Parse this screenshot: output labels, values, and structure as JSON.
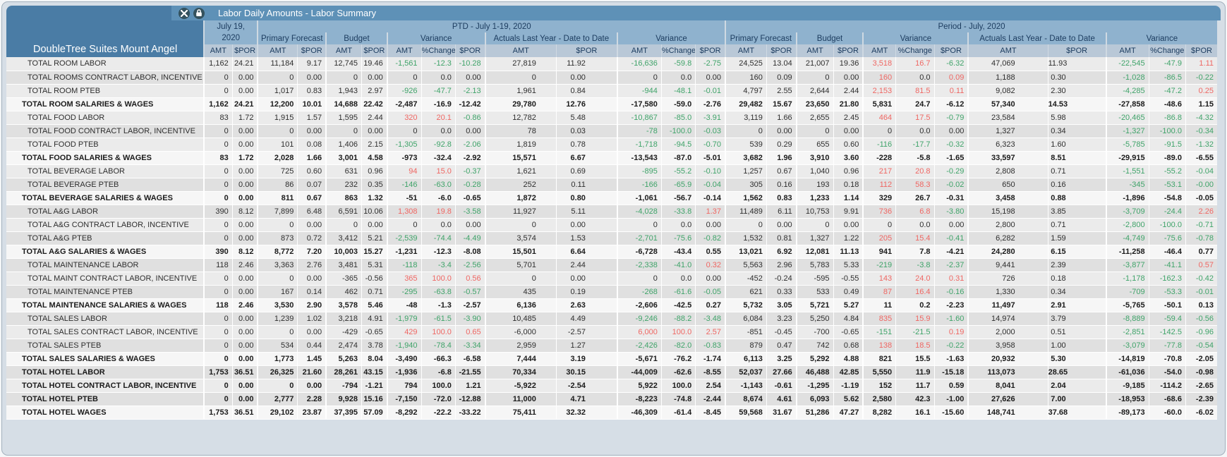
{
  "title_bar": {
    "title": "Labor Daily Amounts - Labor Summary",
    "icons": [
      "tools-icon",
      "lock-icon"
    ]
  },
  "hotel_name": "DoubleTree Suites Mount Angel",
  "colors": {
    "panel_bg": "#d6dee6",
    "header_blue": "#4a7ca5",
    "title_bar_blue": "#5e91b7",
    "group_header_blue": "#8fb2ce",
    "subheader_blue": "#b9c8d7",
    "header_text_navy": "#1d3d60",
    "favorable_green": "#3fa369",
    "unfavorable_red": "#ef6763"
  },
  "columns": {
    "day": {
      "label_line1": "July 19,",
      "label_line2": "2020",
      "cols": [
        "AMT",
        "$POR"
      ]
    },
    "ptd": {
      "label": "PTD - July 1-19, 2020",
      "groups": [
        {
          "label": "Primary Forecast",
          "cols": [
            "AMT",
            "$POR"
          ]
        },
        {
          "label": "Budget",
          "cols": [
            "AMT",
            "$POR"
          ]
        },
        {
          "label": "Variance",
          "cols": [
            "AMT",
            "%Change",
            "$POR"
          ]
        },
        {
          "label": "Actuals Last Year - Date to Date",
          "cols": [
            "AMT",
            "$POR"
          ]
        },
        {
          "label": "Variance",
          "cols": [
            "AMT",
            "%Change",
            "$POR"
          ]
        }
      ]
    },
    "period": {
      "label": "Period - July, 2020",
      "groups": [
        {
          "label": "Primary Forecast",
          "cols": [
            "AMT",
            "$POR"
          ]
        },
        {
          "label": "Budget",
          "cols": [
            "AMT",
            "$POR"
          ]
        },
        {
          "label": "Variance",
          "cols": [
            "AMT",
            "%Change",
            "$POR"
          ]
        },
        {
          "label": "Actuals Last Year - Date to Date",
          "cols": [
            "AMT",
            "$POR"
          ]
        },
        {
          "label": "Variance",
          "cols": [
            "AMT",
            "%Change",
            "$POR"
          ]
        }
      ]
    }
  },
  "rows": [
    {
      "label": "TOTAL ROOM LABOR",
      "bold": false,
      "shade": "a",
      "invert": false,
      "values": [
        "1,162",
        "24.21",
        "11,184",
        "9.17",
        "12,745",
        "19.46",
        "-1,561",
        "-12.3",
        "-10.28",
        "27,819",
        "11.92",
        "-16,636",
        "-59.8",
        "-2.75",
        "24,525",
        "13.04",
        "21,007",
        "19.36",
        "3,518",
        "16.7",
        "-6.32",
        "47,069",
        "11.93",
        "-22,545",
        "-47.9",
        "1.11"
      ]
    },
    {
      "label": "TOTAL ROOMS CONTRACT LABOR, INCENTIVE",
      "bold": false,
      "shade": "b",
      "invert": false,
      "values": [
        "0",
        "0.00",
        "0",
        "0.00",
        "0",
        "0.00",
        "0",
        "0.0",
        "0.00",
        "0",
        "0.00",
        "0",
        "0.0",
        "0.00",
        "160",
        "0.09",
        "0",
        "0.00",
        "160",
        "0.0",
        "0.09",
        "1,188",
        "0.30",
        "-1,028",
        "-86.5",
        "-0.22"
      ]
    },
    {
      "label": "TOTAL ROOM PTEB",
      "bold": false,
      "shade": "a",
      "invert": false,
      "values": [
        "0",
        "0.00",
        "1,017",
        "0.83",
        "1,943",
        "2.97",
        "-926",
        "-47.7",
        "-2.13",
        "1,961",
        "0.84",
        "-944",
        "-48.1",
        "-0.01",
        "4,797",
        "2.55",
        "2,644",
        "2.44",
        "2,153",
        "81.5",
        "0.11",
        "9,082",
        "2.30",
        "-4,285",
        "-47.2",
        "0.25"
      ]
    },
    {
      "label": "TOTAL ROOM SALARIES & WAGES",
      "bold": true,
      "shade": "t",
      "invert": false,
      "values": [
        "1,162",
        "24.21",
        "12,200",
        "10.01",
        "14,688",
        "22.42",
        "-2,487",
        "-16.9",
        "-12.42",
        "29,780",
        "12.76",
        "-17,580",
        "-59.0",
        "-2.76",
        "29,482",
        "15.67",
        "23,650",
        "21.80",
        "5,831",
        "24.7",
        "-6.12",
        "57,340",
        "14.53",
        "-27,858",
        "-48.6",
        "1.15"
      ]
    },
    {
      "label": "TOTAL FOOD LABOR",
      "bold": false,
      "shade": "a",
      "invert": false,
      "values": [
        "83",
        "1.72",
        "1,915",
        "1.57",
        "1,595",
        "2.44",
        "320",
        "20.1",
        "-0.86",
        "12,782",
        "5.48",
        "-10,867",
        "-85.0",
        "-3.91",
        "3,119",
        "1.66",
        "2,655",
        "2.45",
        "464",
        "17.5",
        "-0.79",
        "23,584",
        "5.98",
        "-20,465",
        "-86.8",
        "-4.32"
      ]
    },
    {
      "label": "TOTAL FOOD CONTRACT LABOR, INCENTIVE",
      "bold": false,
      "shade": "b",
      "invert": false,
      "values": [
        "0",
        "0.00",
        "0",
        "0.00",
        "0",
        "0.00",
        "0",
        "0.0",
        "0.00",
        "78",
        "0.03",
        "-78",
        "-100.0",
        "-0.03",
        "0",
        "0.00",
        "0",
        "0.00",
        "0",
        "0.0",
        "0.00",
        "1,327",
        "0.34",
        "-1,327",
        "-100.0",
        "-0.34"
      ]
    },
    {
      "label": "TOTAL FOOD PTEB",
      "bold": false,
      "shade": "a",
      "invert": false,
      "values": [
        "0",
        "0.00",
        "101",
        "0.08",
        "1,406",
        "2.15",
        "-1,305",
        "-92.8",
        "-2.06",
        "1,819",
        "0.78",
        "-1,718",
        "-94.5",
        "-0.70",
        "539",
        "0.29",
        "655",
        "0.60",
        "-116",
        "-17.7",
        "-0.32",
        "6,323",
        "1.60",
        "-5,785",
        "-91.5",
        "-1.32"
      ]
    },
    {
      "label": "TOTAL FOOD SALARIES & WAGES",
      "bold": true,
      "shade": "t",
      "invert": false,
      "values": [
        "83",
        "1.72",
        "2,028",
        "1.66",
        "3,001",
        "4.58",
        "-973",
        "-32.4",
        "-2.92",
        "15,571",
        "6.67",
        "-13,543",
        "-87.0",
        "-5.01",
        "3,682",
        "1.96",
        "3,910",
        "3.60",
        "-228",
        "-5.8",
        "-1.65",
        "33,597",
        "8.51",
        "-29,915",
        "-89.0",
        "-6.55"
      ]
    },
    {
      "label": "TOTAL BEVERAGE LABOR",
      "bold": false,
      "shade": "a",
      "invert": false,
      "values": [
        "0",
        "0.00",
        "725",
        "0.60",
        "631",
        "0.96",
        "94",
        "15.0",
        "-0.37",
        "1,621",
        "0.69",
        "-895",
        "-55.2",
        "-0.10",
        "1,257",
        "0.67",
        "1,040",
        "0.96",
        "217",
        "20.8",
        "-0.29",
        "2,808",
        "0.71",
        "-1,551",
        "-55.2",
        "-0.04"
      ]
    },
    {
      "label": "TOTAL BEVERAGE PTEB",
      "bold": false,
      "shade": "b",
      "invert": false,
      "values": [
        "0",
        "0.00",
        "86",
        "0.07",
        "232",
        "0.35",
        "-146",
        "-63.0",
        "-0.28",
        "252",
        "0.11",
        "-166",
        "-65.9",
        "-0.04",
        "305",
        "0.16",
        "193",
        "0.18",
        "112",
        "58.3",
        "-0.02",
        "650",
        "0.16",
        "-345",
        "-53.1",
        "-0.00"
      ]
    },
    {
      "label": "TOTAL BEVERAGE SALARIES & WAGES",
      "bold": true,
      "shade": "t",
      "invert": false,
      "values": [
        "0",
        "0.00",
        "811",
        "0.67",
        "863",
        "1.32",
        "-51",
        "-6.0",
        "-0.65",
        "1,872",
        "0.80",
        "-1,061",
        "-56.7",
        "-0.14",
        "1,562",
        "0.83",
        "1,233",
        "1.14",
        "329",
        "26.7",
        "-0.31",
        "3,458",
        "0.88",
        "-1,896",
        "-54.8",
        "-0.05"
      ]
    },
    {
      "label": "TOTAL A&G LABOR",
      "bold": false,
      "shade": "b",
      "invert": false,
      "values": [
        "390",
        "8.12",
        "7,899",
        "6.48",
        "6,591",
        "10.06",
        "1,308",
        "19.8",
        "-3.58",
        "11,927",
        "5.11",
        "-4,028",
        "-33.8",
        "1.37",
        "11,489",
        "6.11",
        "10,753",
        "9.91",
        "736",
        "6.8",
        "-3.80",
        "15,198",
        "3.85",
        "-3,709",
        "-24.4",
        "2.26"
      ]
    },
    {
      "label": "TOTAL A&G CONTRACT LABOR, INCENTIVE",
      "bold": false,
      "shade": "a",
      "invert": false,
      "values": [
        "0",
        "0.00",
        "0",
        "0.00",
        "0",
        "0.00",
        "0",
        "0.0",
        "0.00",
        "0",
        "0.00",
        "0",
        "0.0",
        "0.00",
        "0",
        "0.00",
        "0",
        "0.00",
        "0",
        "0.0",
        "0.00",
        "2,800",
        "0.71",
        "-2,800",
        "-100.0",
        "-0.71"
      ]
    },
    {
      "label": "TOTAL A&G PTEB",
      "bold": false,
      "shade": "b",
      "invert": false,
      "values": [
        "0",
        "0.00",
        "873",
        "0.72",
        "3,412",
        "5.21",
        "-2,539",
        "-74.4",
        "-4.49",
        "3,574",
        "1.53",
        "-2,701",
        "-75.6",
        "-0.82",
        "1,532",
        "0.81",
        "1,327",
        "1.22",
        "205",
        "15.4",
        "-0.41",
        "6,282",
        "1.59",
        "-4,749",
        "-75.6",
        "-0.78"
      ]
    },
    {
      "label": "TOTAL A&G SALARIES & WAGES",
      "bold": true,
      "shade": "t",
      "invert": false,
      "values": [
        "390",
        "8.12",
        "8,772",
        "7.20",
        "10,003",
        "15.27",
        "-1,231",
        "-12.3",
        "-8.08",
        "15,501",
        "6.64",
        "-6,728",
        "-43.4",
        "0.55",
        "13,021",
        "6.92",
        "12,081",
        "11.13",
        "941",
        "7.8",
        "-4.21",
        "24,280",
        "6.15",
        "-11,258",
        "-46.4",
        "0.77"
      ]
    },
    {
      "label": "TOTAL MAINTENANCE LABOR",
      "bold": false,
      "shade": "b",
      "invert": false,
      "values": [
        "118",
        "2.46",
        "3,363",
        "2.76",
        "3,481",
        "5.31",
        "-118",
        "-3.4",
        "-2.56",
        "5,701",
        "2.44",
        "-2,338",
        "-41.0",
        "0.32",
        "5,563",
        "2.96",
        "5,783",
        "5.33",
        "-219",
        "-3.8",
        "-2.37",
        "9,441",
        "2.39",
        "-3,877",
        "-41.1",
        "0.57"
      ]
    },
    {
      "label": "TOTAL MAINT CONTRACT LABOR, INCENTIVE",
      "bold": false,
      "shade": "a",
      "invert": false,
      "values": [
        "0",
        "0.00",
        "0",
        "0.00",
        "-365",
        "-0.56",
        "365",
        "100.0",
        "0.56",
        "0",
        "0.00",
        "0",
        "0.0",
        "0.00",
        "-452",
        "-0.24",
        "-595",
        "-0.55",
        "143",
        "24.0",
        "0.31",
        "726",
        "0.18",
        "-1,178",
        "-162.3",
        "-0.42"
      ]
    },
    {
      "label": "TOTAL MAINTENANCE PTEB",
      "bold": false,
      "shade": "b",
      "invert": false,
      "values": [
        "0",
        "0.00",
        "167",
        "0.14",
        "462",
        "0.71",
        "-295",
        "-63.8",
        "-0.57",
        "435",
        "0.19",
        "-268",
        "-61.6",
        "-0.05",
        "621",
        "0.33",
        "533",
        "0.49",
        "87",
        "16.4",
        "-0.16",
        "1,330",
        "0.34",
        "-709",
        "-53.3",
        "-0.01"
      ]
    },
    {
      "label": "TOTAL MAINTENANCE SALARIES & WAGES",
      "bold": true,
      "shade": "t",
      "invert": false,
      "values": [
        "118",
        "2.46",
        "3,530",
        "2.90",
        "3,578",
        "5.46",
        "-48",
        "-1.3",
        "-2.57",
        "6,136",
        "2.63",
        "-2,606",
        "-42.5",
        "0.27",
        "5,732",
        "3.05",
        "5,721",
        "5.27",
        "11",
        "0.2",
        "-2.23",
        "11,497",
        "2.91",
        "-5,765",
        "-50.1",
        "0.13"
      ]
    },
    {
      "label": "TOTAL SALES LABOR",
      "bold": false,
      "shade": "b",
      "invert": false,
      "values": [
        "0",
        "0.00",
        "1,239",
        "1.02",
        "3,218",
        "4.91",
        "-1,979",
        "-61.5",
        "-3.90",
        "10,485",
        "4.49",
        "-9,246",
        "-88.2",
        "-3.48",
        "6,084",
        "3.23",
        "5,250",
        "4.84",
        "835",
        "15.9",
        "-1.60",
        "14,974",
        "3.79",
        "-8,889",
        "-59.4",
        "-0.56"
      ]
    },
    {
      "label": "TOTAL SALES CONTRACT LABOR, INCENTIVE",
      "bold": false,
      "shade": "a",
      "invert": false,
      "values": [
        "0",
        "0.00",
        "0",
        "0.00",
        "-429",
        "-0.65",
        "429",
        "100.0",
        "0.65",
        "-6,000",
        "-2.57",
        "6,000",
        "100.0",
        "2.57",
        "-851",
        "-0.45",
        "-700",
        "-0.65",
        "-151",
        "-21.5",
        "0.19",
        "2,000",
        "0.51",
        "-2,851",
        "-142.5",
        "-0.96"
      ]
    },
    {
      "label": "TOTAL SALES PTEB",
      "bold": false,
      "shade": "b",
      "invert": false,
      "values": [
        "0",
        "0.00",
        "534",
        "0.44",
        "2,474",
        "3.78",
        "-1,940",
        "-78.4",
        "-3.34",
        "2,959",
        "1.27",
        "-2,426",
        "-82.0",
        "-0.83",
        "879",
        "0.47",
        "742",
        "0.68",
        "138",
        "18.5",
        "-0.22",
        "3,958",
        "1.00",
        "-3,079",
        "-77.8",
        "-0.54"
      ]
    },
    {
      "label": "TOTAL SALES SALARIES & WAGES",
      "bold": true,
      "shade": "t",
      "invert": false,
      "values": [
        "0",
        "0.00",
        "1,773",
        "1.45",
        "5,263",
        "8.04",
        "-3,490",
        "-66.3",
        "-6.58",
        "7,444",
        "3.19",
        "-5,671",
        "-76.2",
        "-1.74",
        "6,113",
        "3.25",
        "5,292",
        "4.88",
        "821",
        "15.5",
        "-1.63",
        "20,932",
        "5.30",
        "-14,819",
        "-70.8",
        "-2.05"
      ]
    },
    {
      "label": "TOTAL HOTEL LABOR",
      "bold": true,
      "shade": "b",
      "invert": false,
      "values": [
        "1,753",
        "36.51",
        "26,325",
        "21.60",
        "28,261",
        "43.15",
        "-1,936",
        "-6.8",
        "-21.55",
        "70,334",
        "30.15",
        "-44,009",
        "-62.6",
        "-8.55",
        "52,037",
        "27.66",
        "46,488",
        "42.85",
        "5,550",
        "11.9",
        "-15.18",
        "113,073",
        "28.65",
        "-61,036",
        "-54.0",
        "-0.98"
      ]
    },
    {
      "label": "TOTAL HOTEL CONTRACT LABOR, INCENTIVE",
      "bold": true,
      "shade": "a",
      "invert": true,
      "values": [
        "0",
        "0.00",
        "0",
        "0.00",
        "-794",
        "-1.21",
        "794",
        "100.0",
        "1.21",
        "-5,922",
        "-2.54",
        "5,922",
        "100.0",
        "2.54",
        "-1,143",
        "-0.61",
        "-1,295",
        "-1.19",
        "152",
        "11.7",
        "0.59",
        "8,041",
        "2.04",
        "-9,185",
        "-114.2",
        "-2.65"
      ]
    },
    {
      "label": "TOTAL HOTEL PTEB",
      "bold": true,
      "shade": "b",
      "invert": false,
      "values": [
        "0",
        "0.00",
        "2,777",
        "2.28",
        "9,928",
        "15.16",
        "-7,150",
        "-72.0",
        "-12.88",
        "11,000",
        "4.71",
        "-8,223",
        "-74.8",
        "-2.44",
        "8,674",
        "4.61",
        "6,093",
        "5.62",
        "2,580",
        "42.3",
        "-1.00",
        "27,626",
        "7.00",
        "-18,953",
        "-68.6",
        "-2.39"
      ]
    },
    {
      "label": "TOTAL HOTEL WAGES",
      "bold": true,
      "shade": "t",
      "invert": false,
      "values": [
        "1,753",
        "36.51",
        "29,102",
        "23.87",
        "37,395",
        "57.09",
        "-8,292",
        "-22.2",
        "-33.22",
        "75,411",
        "32.32",
        "-46,309",
        "-61.4",
        "-8.45",
        "59,568",
        "31.67",
        "51,286",
        "47.27",
        "8,282",
        "16.1",
        "-15.60",
        "148,741",
        "37.68",
        "-89,173",
        "-60.0",
        "-6.02"
      ]
    }
  ]
}
